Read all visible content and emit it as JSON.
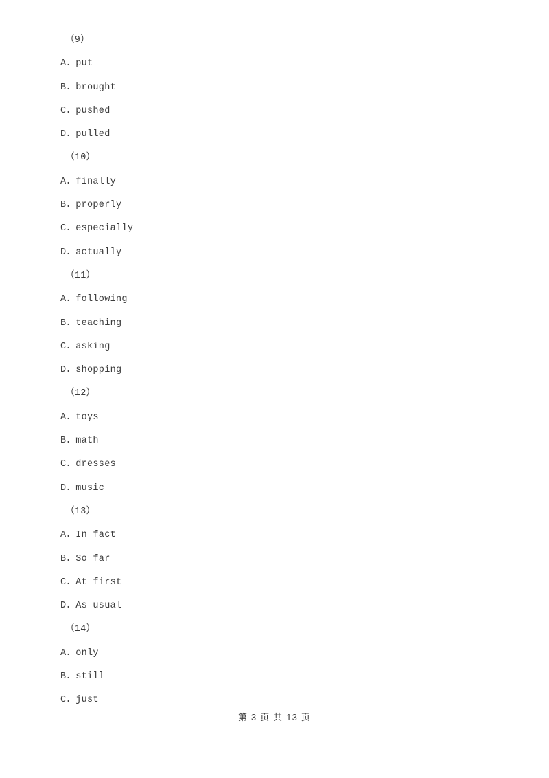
{
  "document": {
    "type": "exam-paper",
    "text_color": "#3c3c3c",
    "background_color": "#ffffff"
  },
  "questions": [
    {
      "number": "（9）",
      "options": [
        "A．put",
        "B．brought",
        "C．pushed",
        "D．pulled"
      ]
    },
    {
      "number": "（10）",
      "options": [
        "A．finally",
        "B．properly",
        "C．especially",
        "D．actually"
      ]
    },
    {
      "number": "（11）",
      "options": [
        "A．following",
        "B．teaching",
        "C．asking",
        "D．shopping"
      ]
    },
    {
      "number": "（12）",
      "options": [
        "A．toys",
        "B．math",
        "C．dresses",
        "D．music"
      ]
    },
    {
      "number": "（13）",
      "options": [
        "A．In fact",
        "B．So far",
        "C．At first",
        "D．As usual"
      ]
    },
    {
      "number": "（14）",
      "options": [
        "A．only",
        "B．still",
        "C．just"
      ]
    }
  ],
  "footer": {
    "page_label": "第 3 页 共 13 页",
    "current_page": "3",
    "total_pages": "13"
  }
}
